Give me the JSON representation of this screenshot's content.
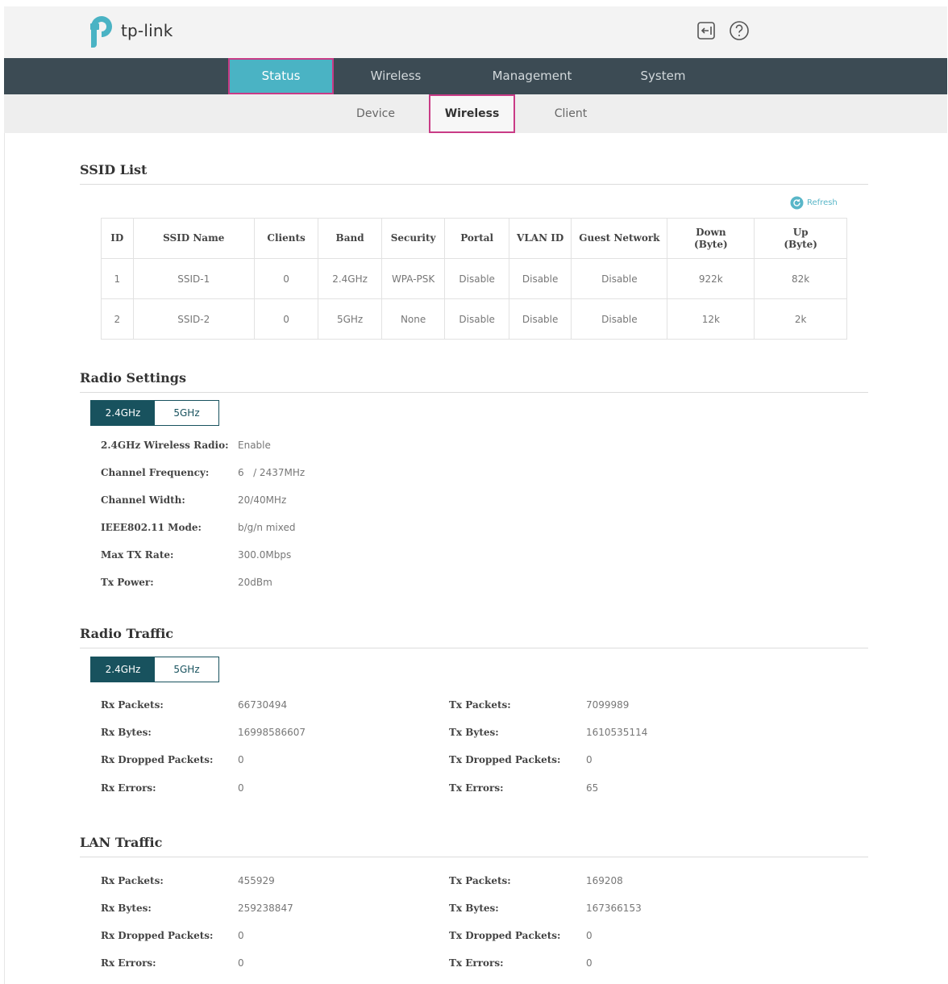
{
  "header": {
    "logo_text": "tp-link",
    "logout_icon": "logout-icon",
    "help_icon": "help-icon"
  },
  "main_nav": [
    {
      "label": "Status",
      "active": true
    },
    {
      "label": "Wireless",
      "active": false
    },
    {
      "label": "Management",
      "active": false
    },
    {
      "label": "System",
      "active": false
    }
  ],
  "sub_nav": [
    {
      "label": "Device",
      "active": false
    },
    {
      "label": "Wireless",
      "active": true
    },
    {
      "label": "Client",
      "active": false
    }
  ],
  "ssid_list": {
    "title": "SSID List",
    "refresh_label": "Refresh",
    "columns": [
      "ID",
      "SSID Name",
      "Clients",
      "Band",
      "Security",
      "Portal",
      "VLAN ID",
      "Guest Network",
      "Down (Byte)",
      "Up (Byte)"
    ],
    "rows": [
      [
        "1",
        "SSID-1",
        "0",
        "2.4GHz",
        "WPA-PSK",
        "Disable",
        "Disable",
        "Disable",
        "922k",
        "82k"
      ],
      [
        "2",
        "SSID-2",
        "0",
        "5GHz",
        "None",
        "Disable",
        "Disable",
        "Disable",
        "12k",
        "2k"
      ]
    ]
  },
  "radio_settings": {
    "title": "Radio Settings",
    "tabs": [
      "2.4GHz",
      "5GHz"
    ],
    "active_tab": "2.4GHz",
    "fields": [
      {
        "label": "2.4GHz Wireless Radio:",
        "value": "Enable"
      },
      {
        "label": "Channel Frequency:",
        "value": "6   / 2437MHz"
      },
      {
        "label": "Channel Width:",
        "value": "20/40MHz"
      },
      {
        "label": "IEEE802.11 Mode:",
        "value": "b/g/n mixed"
      },
      {
        "label": "Max TX Rate:",
        "value": "300.0Mbps"
      },
      {
        "label": "Tx Power:",
        "value": "20dBm"
      }
    ]
  },
  "radio_traffic": {
    "title": "Radio Traffic",
    "tabs": [
      "2.4GHz",
      "5GHz"
    ],
    "active_tab": "2.4GHz",
    "rx": [
      {
        "label": "Rx Packets:",
        "value": "66730494"
      },
      {
        "label": "Rx Bytes:",
        "value": "16998586607"
      },
      {
        "label": "Rx Dropped Packets:",
        "value": "0"
      },
      {
        "label": "Rx Errors:",
        "value": "0"
      }
    ],
    "tx": [
      {
        "label": "Tx Packets:",
        "value": "7099989"
      },
      {
        "label": "Tx Bytes:",
        "value": "1610535114"
      },
      {
        "label": "Tx Dropped Packets:",
        "value": "0"
      },
      {
        "label": "Tx Errors:",
        "value": "65"
      }
    ]
  },
  "lan_traffic": {
    "title": "LAN Traffic",
    "rx": [
      {
        "label": "Rx Packets:",
        "value": "455929"
      },
      {
        "label": "Rx Bytes:",
        "value": "259238847"
      },
      {
        "label": "Rx Dropped Packets:",
        "value": "0"
      },
      {
        "label": "Rx Errors:",
        "value": "0"
      }
    ],
    "tx": [
      {
        "label": "Tx Packets:",
        "value": "169208"
      },
      {
        "label": "Tx Bytes:",
        "value": "167366153"
      },
      {
        "label": "Tx Dropped Packets:",
        "value": "0"
      },
      {
        "label": "Tx Errors:",
        "value": "0"
      }
    ]
  },
  "colors": {
    "nav_bg": "#3c4b54",
    "nav_active": "#4ab3c4",
    "highlight_border": "#c93b86",
    "toggle_active": "#18525e",
    "accent": "#59b6c8"
  }
}
